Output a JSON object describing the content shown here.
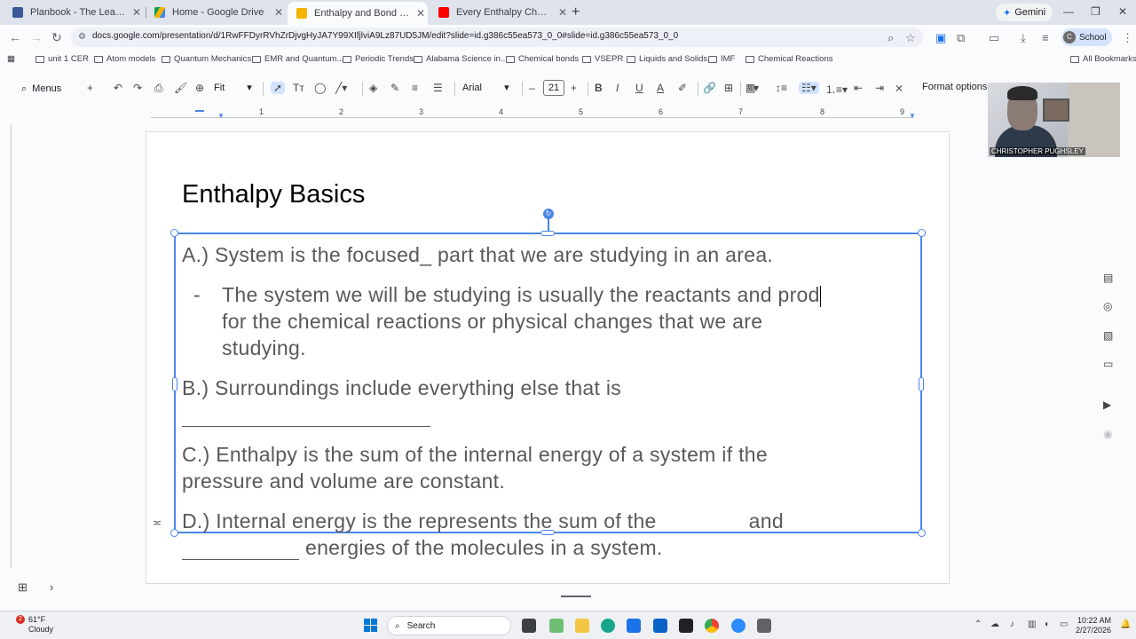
{
  "browser": {
    "tabs": [
      {
        "title": "Planbook - The Leader in Lesso",
        "active": false
      },
      {
        "title": "Home - Google Drive",
        "active": false
      },
      {
        "title": "Enthalpy and Bond energy - Go",
        "active": true
      },
      {
        "title": "Every Enthalpy Change Animate",
        "active": false
      }
    ],
    "gemini_label": "Gemini",
    "url": "docs.google.com/presentation/d/1RwFFDyrRVhZrDjvgHyJA7Y99XIfjlviA9Lz87UD5JM/edit?slide=id.g386c55ea573_0_0#slide=id.g386c55ea573_0_0",
    "profile_label": "School"
  },
  "bookmarks": {
    "items": [
      "unit 1 CER",
      "Atom models",
      "Quantum Mechanics",
      "EMR and Quantum...",
      "Periodic Trends",
      "Alabama Science in...",
      "Chemical bonds",
      "VSEPR",
      "Liquids and Solids",
      "IMF",
      "Chemical Reactions"
    ],
    "all_bookmarks": "All Bookmarks"
  },
  "toolbar": {
    "menus_label": "Menus",
    "zoom": "Fit",
    "font": "Arial",
    "font_size": "21",
    "format_options": "Format options"
  },
  "ruler": {
    "numbers": [
      "1",
      "2",
      "3",
      "4",
      "5",
      "6",
      "7",
      "8",
      "9"
    ]
  },
  "slide": {
    "title": "Enthalpy Basics",
    "a_line": "A.) System is the focused_ part that we are studying in an area.",
    "a_sub_dash": "-",
    "a_sub_1": "The system we will be studying is usually the reactants and prod",
    "a_sub_2": "for the chemical reactions or physical changes that we are",
    "a_sub_3": "studying.",
    "b_line": "B.) Surroundings include everything else that is",
    "c_line_1": "C.) Enthalpy is the sum of the internal energy of a system if the",
    "c_line_2": "pressure and volume are constant.",
    "d_line_1a": "D.) Internal energy is the represents the sum of the",
    "d_line_1b": "and",
    "d_line_2": "energies of the molecules in a system."
  },
  "video": {
    "participant_name": "CHRISTOPHER PUGHSLEY"
  },
  "taskbar": {
    "weather_temp": "61°F",
    "weather_desc": "Cloudy",
    "weather_badge": "2",
    "search_label": "Search",
    "time": "10:22 AM",
    "date": "2/27/2026"
  },
  "colors": {
    "accent": "#4a86e8",
    "body_text": "#595959",
    "title_text": "#000000"
  }
}
